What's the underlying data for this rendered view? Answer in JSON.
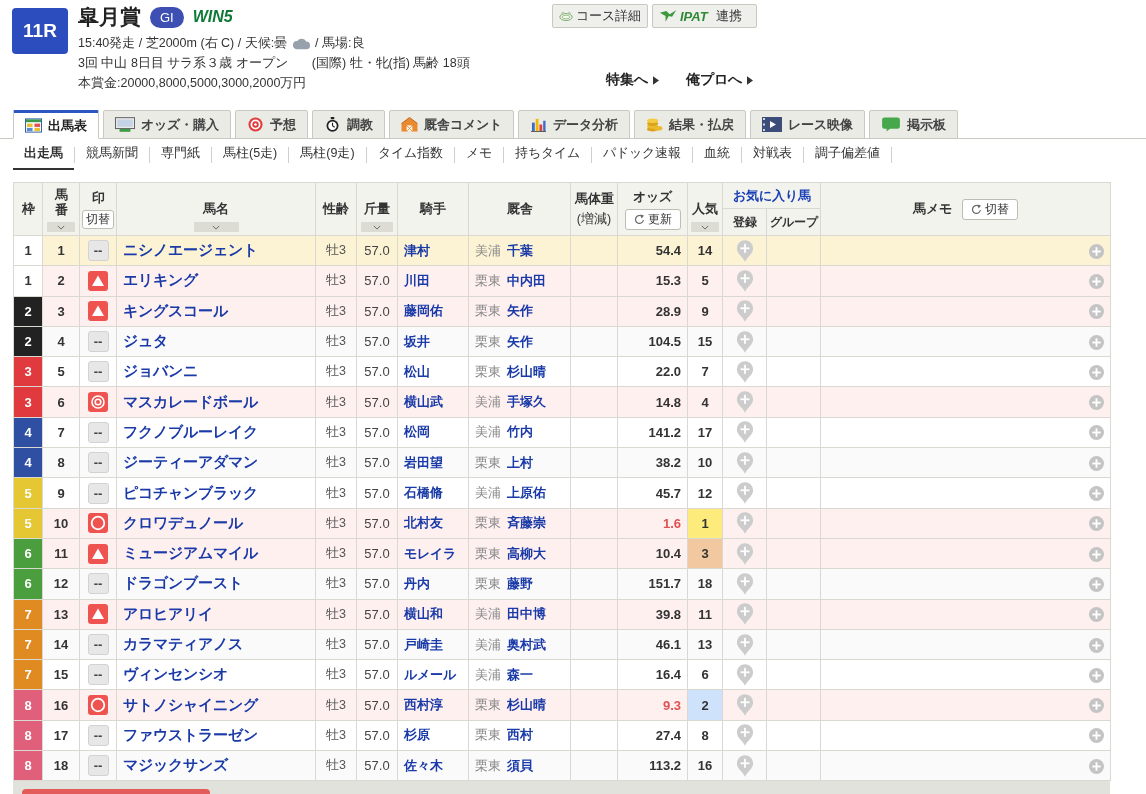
{
  "race": {
    "number": "11R",
    "name": "皐月賞",
    "grade": "GI",
    "win5": "WIN5",
    "conditions": [
      "15:40発走 / 芝2000m (右 C) / 天候:曇",
      "/ 馬場:良"
    ],
    "class_line": [
      "3回 中山 8日目 サラ系３歳 オープン",
      "(国際) 牡・牝(指) 馬齢 18頭"
    ],
    "prize": "本賞金:20000,8000,5000,3000,2000万円"
  },
  "top_buttons": [
    {
      "label": "コース詳細"
    },
    {
      "logo": "IPAT",
      "label": "連携"
    }
  ],
  "links": [
    "特集へ",
    "俺プロへ"
  ],
  "tabs": [
    {
      "label": "出馬表",
      "selected": true
    },
    {
      "label": "オッズ・購入",
      "selected": false
    },
    {
      "label": "予想",
      "selected": false
    },
    {
      "label": "調教",
      "selected": false
    },
    {
      "label": "厩舎コメント",
      "selected": false
    },
    {
      "label": "データ分析",
      "selected": false
    },
    {
      "label": "結果・払戻",
      "selected": false
    },
    {
      "label": "レース映像",
      "selected": false
    },
    {
      "label": "掲示板",
      "selected": false
    }
  ],
  "subnav": [
    {
      "label": "出走馬",
      "selected": true
    },
    {
      "label": "競馬新聞",
      "selected": false
    },
    {
      "label": "専門紙",
      "selected": false
    },
    {
      "label": "馬柱(5走)",
      "selected": false
    },
    {
      "label": "馬柱(9走)",
      "selected": false
    },
    {
      "label": "タイム指数",
      "selected": false
    },
    {
      "label": "メモ",
      "selected": false
    },
    {
      "label": "持ちタイム",
      "selected": false
    },
    {
      "label": "パドック速報",
      "selected": false
    },
    {
      "label": "血統",
      "selected": false
    },
    {
      "label": "対戦表",
      "selected": false
    },
    {
      "label": "調子偏差値",
      "selected": false
    }
  ],
  "table": {
    "columns": [
      {
        "label": "枠",
        "sortable": false
      },
      {
        "label": "馬番",
        "sortable": true
      },
      {
        "label": "印",
        "sortable": false,
        "button": {
          "label": "切替",
          "refresh": false
        }
      },
      {
        "label": "馬名",
        "sortable": true
      },
      {
        "label": "性齢",
        "sortable": false
      },
      {
        "label": "斤量",
        "sortable": true
      },
      {
        "label": "騎手",
        "sortable": false
      },
      {
        "label": "厩舎",
        "sortable": false
      },
      {
        "label": "馬体重",
        "sublabel": "(増減)",
        "sortable": false
      },
      {
        "label": "オッズ",
        "sortable": false,
        "button": {
          "label": "更新",
          "refresh": true
        }
      },
      {
        "label": "人気",
        "sortable": true
      },
      {
        "label": "お気に入り馬",
        "sortable": false,
        "children": [
          "登録",
          "グループ"
        ]
      },
      {
        "label": "馬メモ",
        "sortable": false,
        "button": {
          "label": "切替",
          "refresh": true
        }
      }
    ],
    "rows": [
      {
        "waku": "1",
        "color": "#ffffff",
        "number": "1",
        "mark": {
          "kind": "none",
          "text": "--"
        },
        "name": "ニシノエージェント",
        "sex_age": "牡3",
        "weight": "57.0",
        "jockey": "津村",
        "region": "美浦",
        "trainer": "千葉",
        "odds": "54.4",
        "odds_highlight": false,
        "popularity": {
          "text": "14"
        },
        "highlighted": true
      },
      {
        "waku": "1",
        "color": "#ffffff",
        "number": "2",
        "mark": {
          "kind": "triangle"
        },
        "name": "エリキング",
        "sex_age": "牡3",
        "weight": "57.0",
        "jockey": "川田",
        "region": "栗東",
        "trainer": "中内田",
        "odds": "15.3",
        "odds_highlight": false,
        "popularity": {
          "text": "5"
        },
        "highlighted": false
      },
      {
        "waku": "2",
        "color": "#222222",
        "number": "3",
        "mark": {
          "kind": "triangle"
        },
        "name": "キングスコール",
        "sex_age": "牡3",
        "weight": "57.0",
        "jockey": "藤岡佑",
        "region": "栗東",
        "trainer": "矢作",
        "odds": "28.9",
        "odds_highlight": false,
        "popularity": {
          "text": "9"
        },
        "highlighted": false
      },
      {
        "waku": "2",
        "color": "#222222",
        "number": "4",
        "mark": {
          "kind": "none",
          "text": "--"
        },
        "name": "ジュタ",
        "sex_age": "牡3",
        "weight": "57.0",
        "jockey": "坂井",
        "region": "栗東",
        "trainer": "矢作",
        "odds": "104.5",
        "odds_highlight": false,
        "popularity": {
          "text": "15"
        },
        "highlighted": false
      },
      {
        "waku": "3",
        "color": "#e03a3e",
        "number": "5",
        "mark": {
          "kind": "none",
          "text": "--"
        },
        "name": "ジョバンニ",
        "sex_age": "牡3",
        "weight": "57.0",
        "jockey": "松山",
        "region": "栗東",
        "trainer": "杉山晴",
        "odds": "22.0",
        "odds_highlight": false,
        "popularity": {
          "text": "7"
        },
        "highlighted": false
      },
      {
        "waku": "3",
        "color": "#e03a3e",
        "number": "6",
        "mark": {
          "kind": "double_circle"
        },
        "name": "マスカレードボール",
        "sex_age": "牡3",
        "weight": "57.0",
        "jockey": "横山武",
        "region": "美浦",
        "trainer": "手塚久",
        "odds": "14.8",
        "odds_highlight": false,
        "popularity": {
          "text": "4"
        },
        "highlighted": false
      },
      {
        "waku": "4",
        "color": "#2f4fa3",
        "number": "7",
        "mark": {
          "kind": "none",
          "text": "--"
        },
        "name": "フクノブルーレイク",
        "sex_age": "牡3",
        "weight": "57.0",
        "jockey": "松岡",
        "region": "美浦",
        "trainer": "竹内",
        "odds": "141.2",
        "odds_highlight": false,
        "popularity": {
          "text": "17"
        },
        "highlighted": false
      },
      {
        "waku": "4",
        "color": "#2f4fa3",
        "number": "8",
        "mark": {
          "kind": "none",
          "text": "--"
        },
        "name": "ジーティーアダマン",
        "sex_age": "牡3",
        "weight": "57.0",
        "jockey": "岩田望",
        "region": "栗東",
        "trainer": "上村",
        "odds": "38.2",
        "odds_highlight": false,
        "popularity": {
          "text": "10"
        },
        "highlighted": false
      },
      {
        "waku": "5",
        "color": "#e4c733",
        "number": "9",
        "mark": {
          "kind": "none",
          "text": "--"
        },
        "name": "ピコチャンブラック",
        "sex_age": "牡3",
        "weight": "57.0",
        "jockey": "石橋脩",
        "region": "美浦",
        "trainer": "上原佑",
        "odds": "45.7",
        "odds_highlight": false,
        "popularity": {
          "text": "12"
        },
        "highlighted": false
      },
      {
        "waku": "5",
        "color": "#e4c733",
        "number": "10",
        "mark": {
          "kind": "circle"
        },
        "name": "クロワデュノール",
        "sex_age": "牡3",
        "weight": "57.0",
        "jockey": "北村友",
        "region": "栗東",
        "trainer": "斉藤崇",
        "odds": "1.6",
        "odds_highlight": true,
        "popularity": {
          "text": "1",
          "color": "#fdeb7b"
        },
        "highlighted": false
      },
      {
        "waku": "6",
        "color": "#4a9e3e",
        "number": "11",
        "mark": {
          "kind": "triangle"
        },
        "name": "ミュージアムマイル",
        "sex_age": "牡3",
        "weight": "57.0",
        "jockey": "モレイラ",
        "region": "栗東",
        "trainer": "高柳大",
        "odds": "10.4",
        "odds_highlight": false,
        "popularity": {
          "text": "3",
          "color": "#f2c8a0"
        },
        "highlighted": false
      },
      {
        "waku": "6",
        "color": "#4a9e3e",
        "number": "12",
        "mark": {
          "kind": "none",
          "text": "--"
        },
        "name": "ドラゴンブースト",
        "sex_age": "牡3",
        "weight": "57.0",
        "jockey": "丹内",
        "region": "栗東",
        "trainer": "藤野",
        "odds": "151.7",
        "odds_highlight": false,
        "popularity": {
          "text": "18"
        },
        "highlighted": false
      },
      {
        "waku": "7",
        "color": "#e08a22",
        "number": "13",
        "mark": {
          "kind": "triangle"
        },
        "name": "アロヒアリイ",
        "sex_age": "牡3",
        "weight": "57.0",
        "jockey": "横山和",
        "region": "美浦",
        "trainer": "田中博",
        "odds": "39.8",
        "odds_highlight": false,
        "popularity": {
          "text": "11"
        },
        "highlighted": false
      },
      {
        "waku": "7",
        "color": "#e08a22",
        "number": "14",
        "mark": {
          "kind": "none",
          "text": "--"
        },
        "name": "カラマティアノス",
        "sex_age": "牡3",
        "weight": "57.0",
        "jockey": "戸崎圭",
        "region": "美浦",
        "trainer": "奥村武",
        "odds": "46.1",
        "odds_highlight": false,
        "popularity": {
          "text": "13"
        },
        "highlighted": false
      },
      {
        "waku": "7",
        "color": "#e08a22",
        "number": "15",
        "mark": {
          "kind": "none",
          "text": "--"
        },
        "name": "ヴィンセンシオ",
        "sex_age": "牡3",
        "weight": "57.0",
        "jockey": "ルメール",
        "region": "美浦",
        "trainer": "森一",
        "odds": "16.4",
        "odds_highlight": false,
        "popularity": {
          "text": "6"
        },
        "highlighted": false
      },
      {
        "waku": "8",
        "color": "#e0607b",
        "number": "16",
        "mark": {
          "kind": "circle"
        },
        "name": "サトノシャイニング",
        "sex_age": "牡3",
        "weight": "57.0",
        "jockey": "西村淳",
        "region": "栗東",
        "trainer": "杉山晴",
        "odds": "9.3",
        "odds_highlight": true,
        "popularity": {
          "text": "2",
          "color": "#cfe2fb"
        },
        "highlighted": false
      },
      {
        "waku": "8",
        "color": "#e0607b",
        "number": "17",
        "mark": {
          "kind": "none",
          "text": "--"
        },
        "name": "ファウストラーゼン",
        "sex_age": "牡3",
        "weight": "57.0",
        "jockey": "杉原",
        "region": "栗東",
        "trainer": "西村",
        "odds": "27.4",
        "odds_highlight": false,
        "popularity": {
          "text": "8"
        },
        "highlighted": false
      },
      {
        "waku": "8",
        "color": "#e0607b",
        "number": "18",
        "mark": {
          "kind": "none",
          "text": "--"
        },
        "name": "マジックサンズ",
        "sex_age": "牡3",
        "weight": "57.0",
        "jockey": "佐々木",
        "region": "栗東",
        "trainer": "須貝",
        "odds": "113.2",
        "odds_highlight": false,
        "popularity": {
          "text": "16"
        },
        "highlighted": false
      }
    ]
  }
}
